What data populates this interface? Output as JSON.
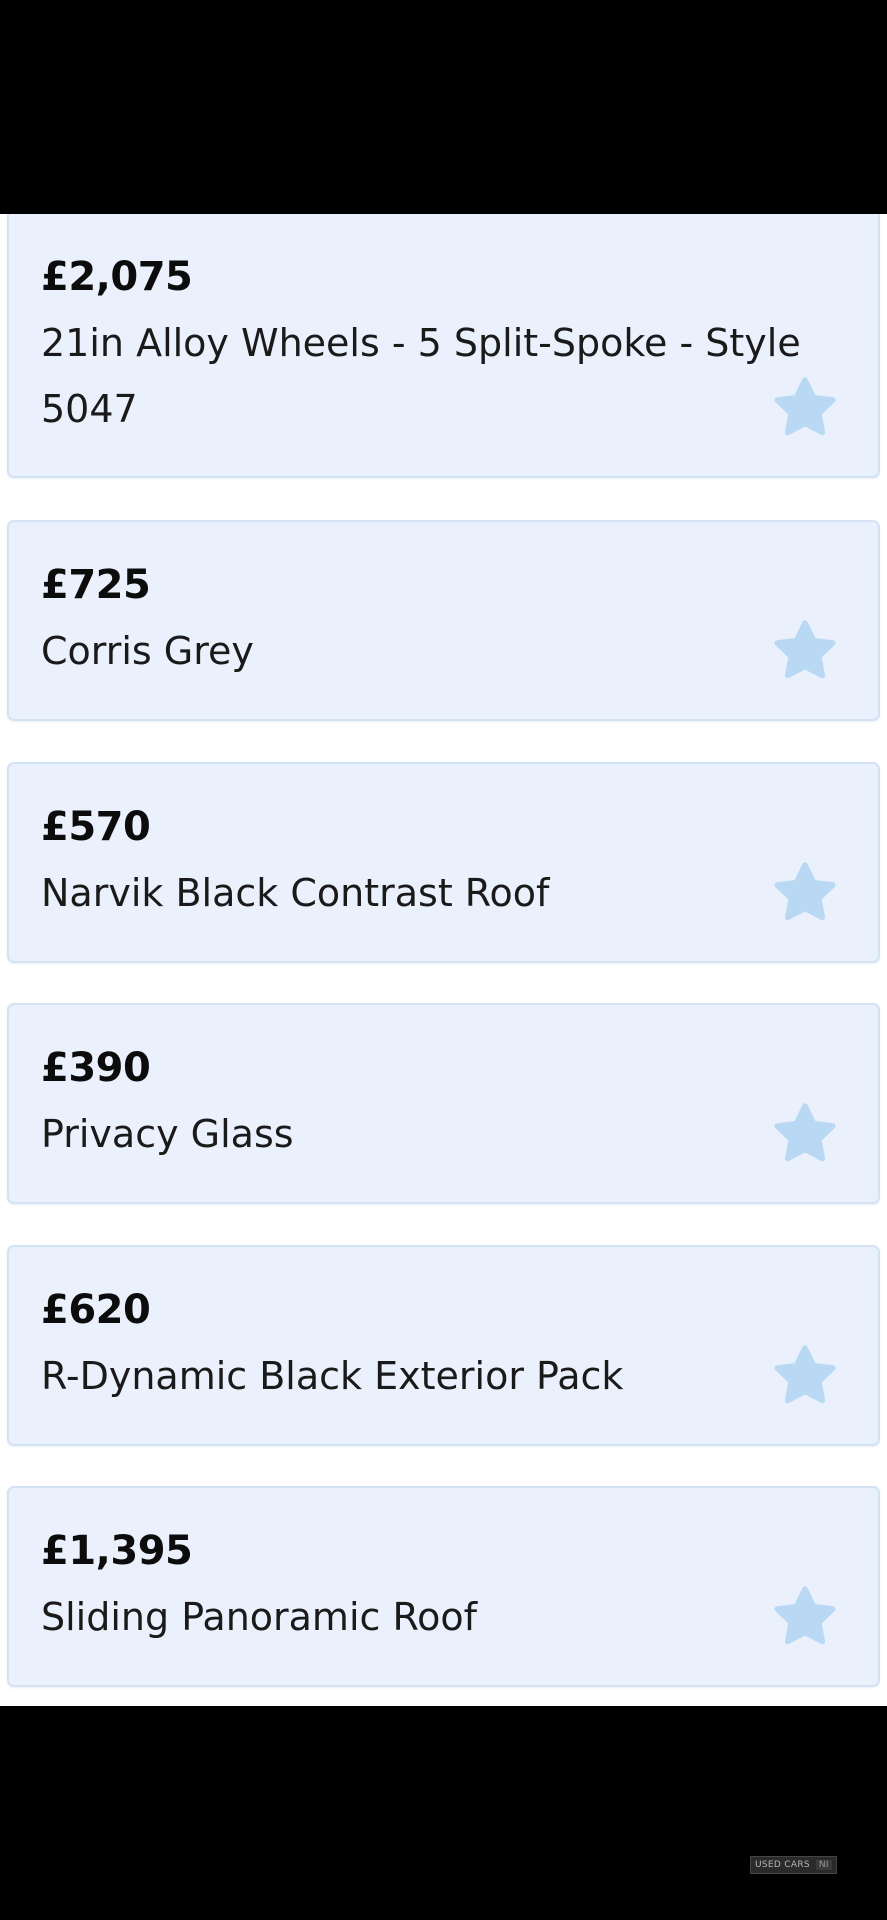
{
  "options": [
    {
      "price": "£2,075",
      "name_line1": "21in Alloy Wheels - 5 Split-Spoke - Style",
      "name_line2": "5047"
    },
    {
      "price": "£725",
      "name_line1": "Corris Grey"
    },
    {
      "price": "£570",
      "name_line1": "Narvik Black Contrast Roof"
    },
    {
      "price": "£390",
      "name_line1": "Privacy Glass"
    },
    {
      "price": "£620",
      "name_line1": "R-Dynamic Black Exterior Pack"
    },
    {
      "price": "£1,395",
      "name_line1": "Sliding Panoramic Roof"
    }
  ],
  "icons": {
    "option_badge": "star-icon"
  },
  "colors": {
    "card_bg": "#eaf1fc",
    "card_border": "#d3e3f5",
    "star": "#b9d8f3"
  },
  "watermark": {
    "text": "USED CARS",
    "suffix": "NI"
  }
}
